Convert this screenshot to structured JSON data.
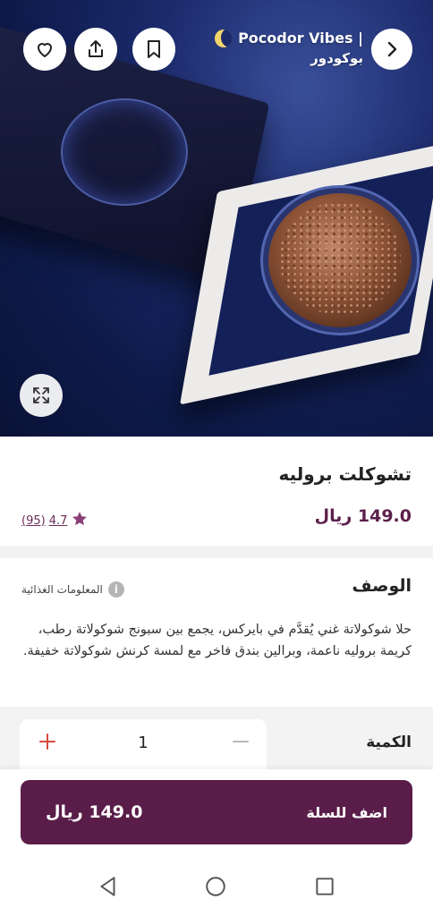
{
  "header": {
    "store_name": "Pocodor Vibes |",
    "store_name_ar": "بوكودور",
    "icons": {
      "favorite": "heart-icon",
      "share": "share-icon",
      "save": "bookmark-icon",
      "next": "chevron-right-icon",
      "expand": "expand-icon"
    }
  },
  "product": {
    "name": "تشوكلت بروليه",
    "price": "149.0 ريال",
    "rating": "4.7",
    "reviews": "(95)"
  },
  "description": {
    "title": "الوصف",
    "nutrition_link": "المعلومات الغذائية",
    "text": "حلا شوكولاتة غني يُقدَّم في بايركس، يجمع بين سبونج شوكولاتة رطب، كريمة بروليه ناعمة، وبرالين بندق فاخر مع لمسة كرنش شوكولاتة خفيفة."
  },
  "quantity": {
    "label": "الكمية",
    "value": "1"
  },
  "cart": {
    "button_label": "اضف للسلة",
    "price": "149.0 ريال"
  },
  "colors": {
    "brand": "#5a1d49",
    "accent_plus": "#d84a3a",
    "rating": "#6a2b57"
  }
}
